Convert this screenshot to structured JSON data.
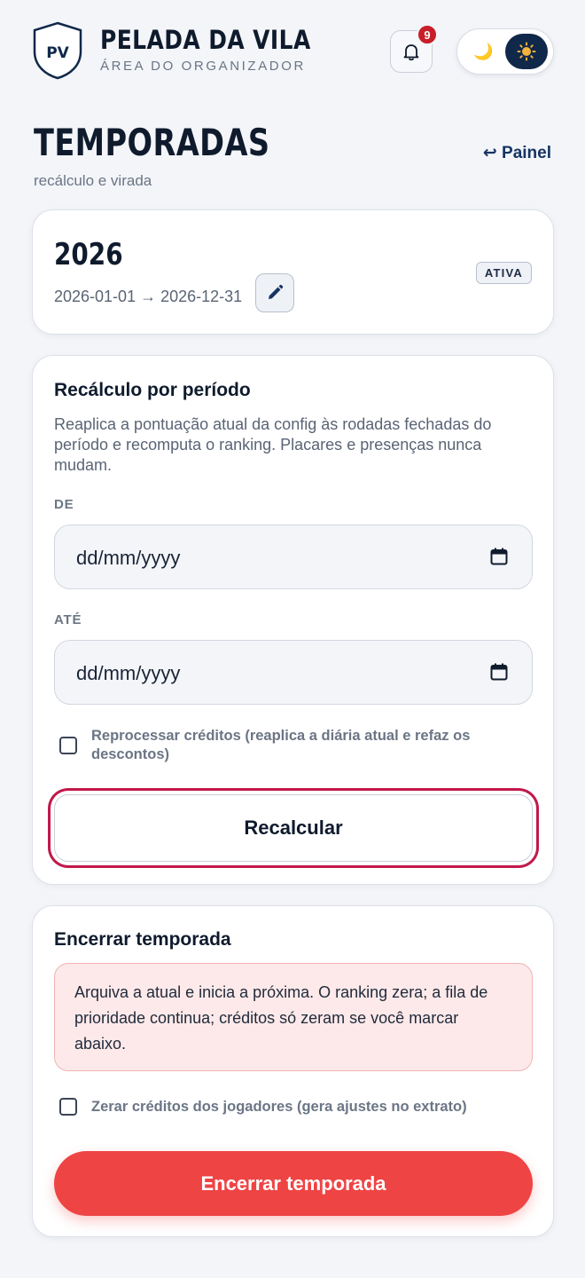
{
  "header": {
    "logo_text": "PV",
    "brand_title": "PELADA DA VILA",
    "brand_subtitle": "ÁREA DO ORGANIZADOR",
    "notification_count": "9",
    "theme_moon": "🌙"
  },
  "page": {
    "title": "TEMPORADAS",
    "subtitle": "recálculo e virada",
    "back_link": "↩ Painel"
  },
  "season": {
    "year": "2026",
    "range": "2026-01-01 → 2026-12-31",
    "status": "ATIVA"
  },
  "recalc": {
    "title": "Recálculo por período",
    "description": "Reaplica a pontuação atual da config às rodadas fechadas do período e recomputa o ranking. Placares e presenças nunca mudam.",
    "from_label": "DE",
    "from_placeholder": "dd/mm/yyyy",
    "to_label": "ATÉ",
    "to_placeholder": "dd/mm/yyyy",
    "reprocess_label": "Reprocessar créditos (reaplica a diária atual e refaz os descontos)",
    "button_label": "Recalcular"
  },
  "close_season": {
    "title": "Encerrar temporada",
    "warning": "Arquiva a atual e inicia a próxima. O ranking zera; a fila de prioridade continua; créditos só zeram se você marcar abaixo.",
    "reset_label": "Zerar créditos dos jogadores (gera ajustes no extrato)",
    "button_label": "Encerrar temporada"
  },
  "colors": {
    "navy": "#0f1b2d",
    "accent_navy": "#163462",
    "danger": "#ef4444",
    "focus_ring": "#c2184a",
    "badge_red": "#c81e2a"
  }
}
